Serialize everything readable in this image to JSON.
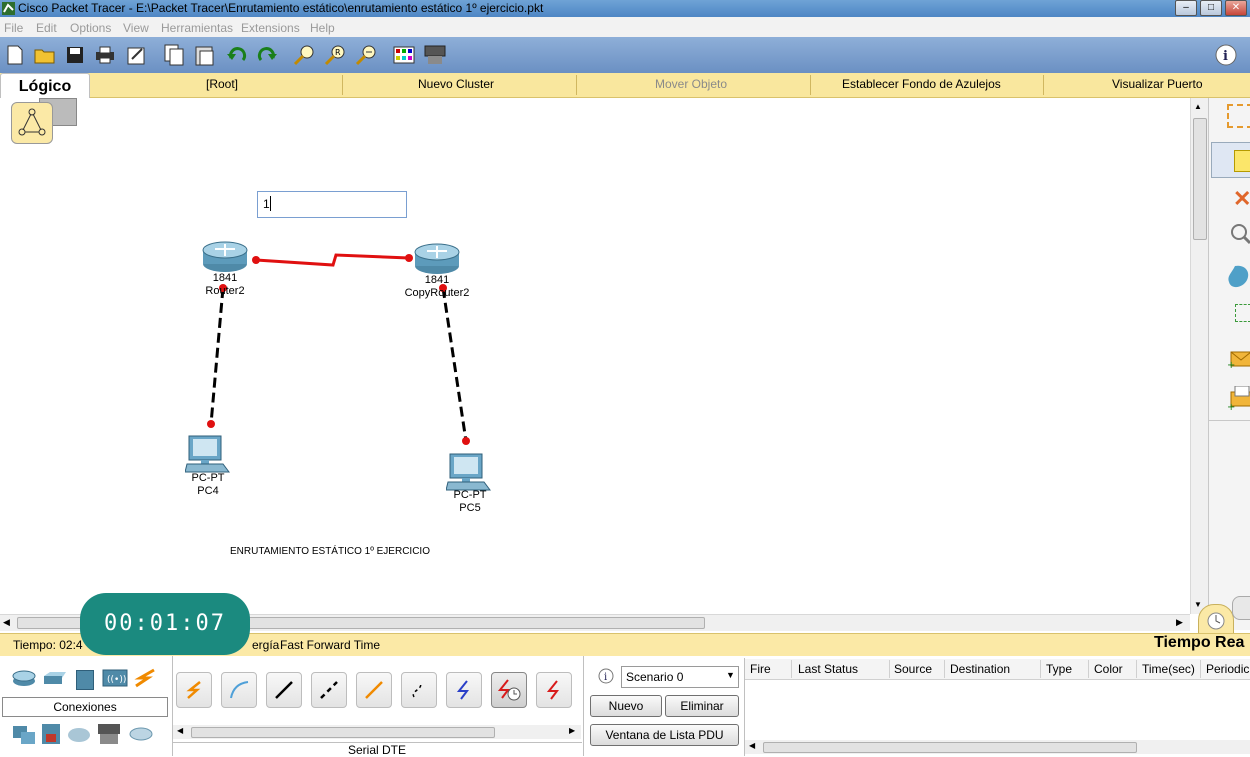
{
  "window": {
    "title": "Cisco Packet Tracer - E:\\Packet Tracer\\Enrutamiento estático\\enrutamiento estático 1º ejercicio.pkt"
  },
  "menu": [
    "File",
    "Edit",
    "Options",
    "View",
    "Herramientas",
    "Extensions",
    "Help"
  ],
  "logic_bar": {
    "tab": "Lógico",
    "root": "[Root]",
    "new_cluster": "Nuevo Cluster",
    "move_object": "Mover Objeto",
    "tile_bg": "Establecer Fondo de Azulejos",
    "viewport": "Visualizar Puerto"
  },
  "workspace": {
    "text_input_value": "1",
    "routers": [
      {
        "model": "1841",
        "name": "Router2"
      },
      {
        "model": "1841",
        "name": "CopyRouter2"
      }
    ],
    "pcs": [
      {
        "model": "PC-PT",
        "name": "PC4"
      },
      {
        "model": "PC-PT",
        "name": "PC5"
      }
    ],
    "note": "ENRUTAMIENTO ESTÁTICO 1º EJERCICIO",
    "link_color": "#e01010"
  },
  "timer": "00:01:07",
  "status_bar": {
    "time_label": "Tiempo: 02:4",
    "energy_fragment": "ergía",
    "fast_forward": "Fast Forward Time",
    "realtime": "Tiempo Rea"
  },
  "bottom": {
    "category_label": "Conexiones",
    "connection_type": "Serial DTE",
    "scenario": "Scenario 0",
    "new_btn": "Nuevo",
    "delete_btn": "Eliminar",
    "pdu_list_btn": "Ventana de Lista PDU",
    "columns": [
      "Fire",
      "Last Status",
      "Source",
      "Destination",
      "Type",
      "Color",
      "Time(sec)",
      "Periodic"
    ]
  },
  "accent_colors": {
    "toolbar": "#7b9ccc",
    "logic_bar": "#f9e79e",
    "timer_bg": "#1b8a7f"
  }
}
